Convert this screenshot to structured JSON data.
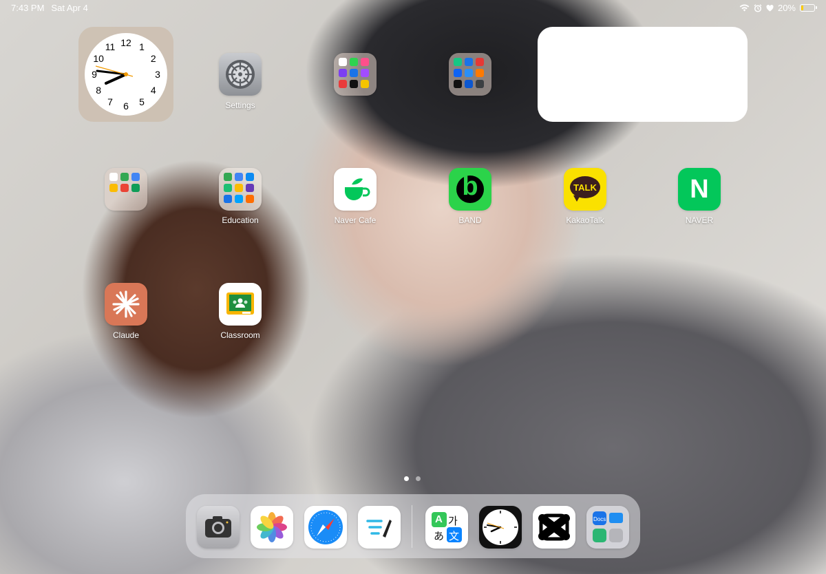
{
  "status": {
    "time": "7:43 PM",
    "date": "Sat Apr 4",
    "battery_percent_text": "20%",
    "battery_level": 0.2,
    "battery_color": "#ffcc00"
  },
  "clock_widget": {
    "numbers": [
      "12",
      "1",
      "2",
      "3",
      "4",
      "5",
      "6",
      "7",
      "8",
      "9",
      "10",
      "11"
    ]
  },
  "home": {
    "apps": [
      {
        "name": "settings",
        "label": "Settings"
      },
      {
        "name": "folder-top-1",
        "label": ""
      },
      {
        "name": "folder-top-2",
        "label": ""
      },
      {
        "name": "folder-left",
        "label": ""
      },
      {
        "name": "education",
        "label": "Education"
      },
      {
        "name": "naver-cafe",
        "label": "Naver Cafe"
      },
      {
        "name": "band",
        "label": "BAND"
      },
      {
        "name": "kakaotalk",
        "label": "KakaoTalk"
      },
      {
        "name": "naver",
        "label": "NAVER"
      },
      {
        "name": "claude",
        "label": "Claude"
      },
      {
        "name": "classroom",
        "label": "Classroom"
      }
    ],
    "icon_text": {
      "band": "b",
      "kakaotalk": "TALK",
      "naver": "N"
    }
  },
  "page_indicator": {
    "pages": 2,
    "current": 1
  },
  "dock": {
    "apps": [
      {
        "name": "camera",
        "icon": "camera-icon"
      },
      {
        "name": "photos",
        "icon": "photos-icon"
      },
      {
        "name": "safari",
        "icon": "safari-icon"
      },
      {
        "name": "freeform",
        "icon": "freeform-icon"
      },
      {
        "name": "translate",
        "icon": "translate-icon",
        "text": [
          "A",
          "가",
          "あ",
          "文"
        ]
      },
      {
        "name": "clock",
        "icon": "clock-icon"
      },
      {
        "name": "capcut",
        "icon": "capcut-icon"
      },
      {
        "name": "app-library",
        "icon": "app-library-icon",
        "text": [
          "Docs"
        ]
      }
    ]
  },
  "colors": {
    "naver_green": "#03c75a",
    "kakao_yellow": "#fae100",
    "claude_orange": "#d97757",
    "band_green": "#2bd34a"
  }
}
